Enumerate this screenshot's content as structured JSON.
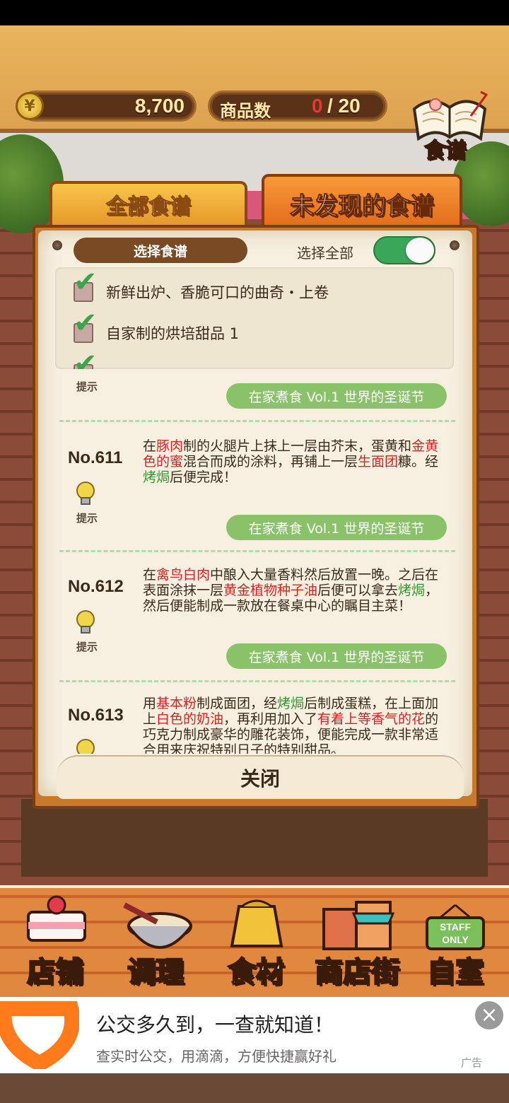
{
  "header": {
    "coin_symbol": "¥",
    "money": "8,700",
    "count_label": "商品数",
    "count_current": "0",
    "count_total": "/ 20",
    "recipe_book_label": "食谱"
  },
  "tabs": {
    "all": "全部食谱",
    "undiscovered": "未发现的食谱"
  },
  "filter": {
    "select_label": "选择食谱",
    "select_all_label": "选择全部",
    "items": [
      "新鲜出炉、香脆可口的曲奇・上卷",
      "自家制的烘培甜品 1"
    ]
  },
  "entries": {
    "e0": {
      "hint": "提示",
      "source": "在家煮食 Vol.1 世界的圣诞节"
    },
    "e611": {
      "no": "No.611",
      "hint": "提示",
      "source": "在家煮食 Vol.1 世界的圣诞节"
    },
    "e612": {
      "no": "No.612",
      "hint": "提示",
      "source": "在家煮食 Vol.1 世界的圣诞节"
    },
    "e613": {
      "no": "No.613",
      "hint": "提示"
    }
  },
  "close_label": "关闭",
  "nav": [
    "店铺",
    "调理",
    "食材",
    "商店街",
    "自室"
  ],
  "nav_staff_sign": "STAFF ONLY",
  "ad": {
    "title": "公交多久到，一查就知道！",
    "subtitle": "查实时公交，用滴滴，方便快捷赢好礼",
    "close": "×",
    "tag": "广告"
  },
  "colors": {
    "highlight_red": "#e02020",
    "highlight_green": "#2a9a2a",
    "toggle_on": "#3aa65a",
    "ad_brand": "#ff7a1a"
  }
}
